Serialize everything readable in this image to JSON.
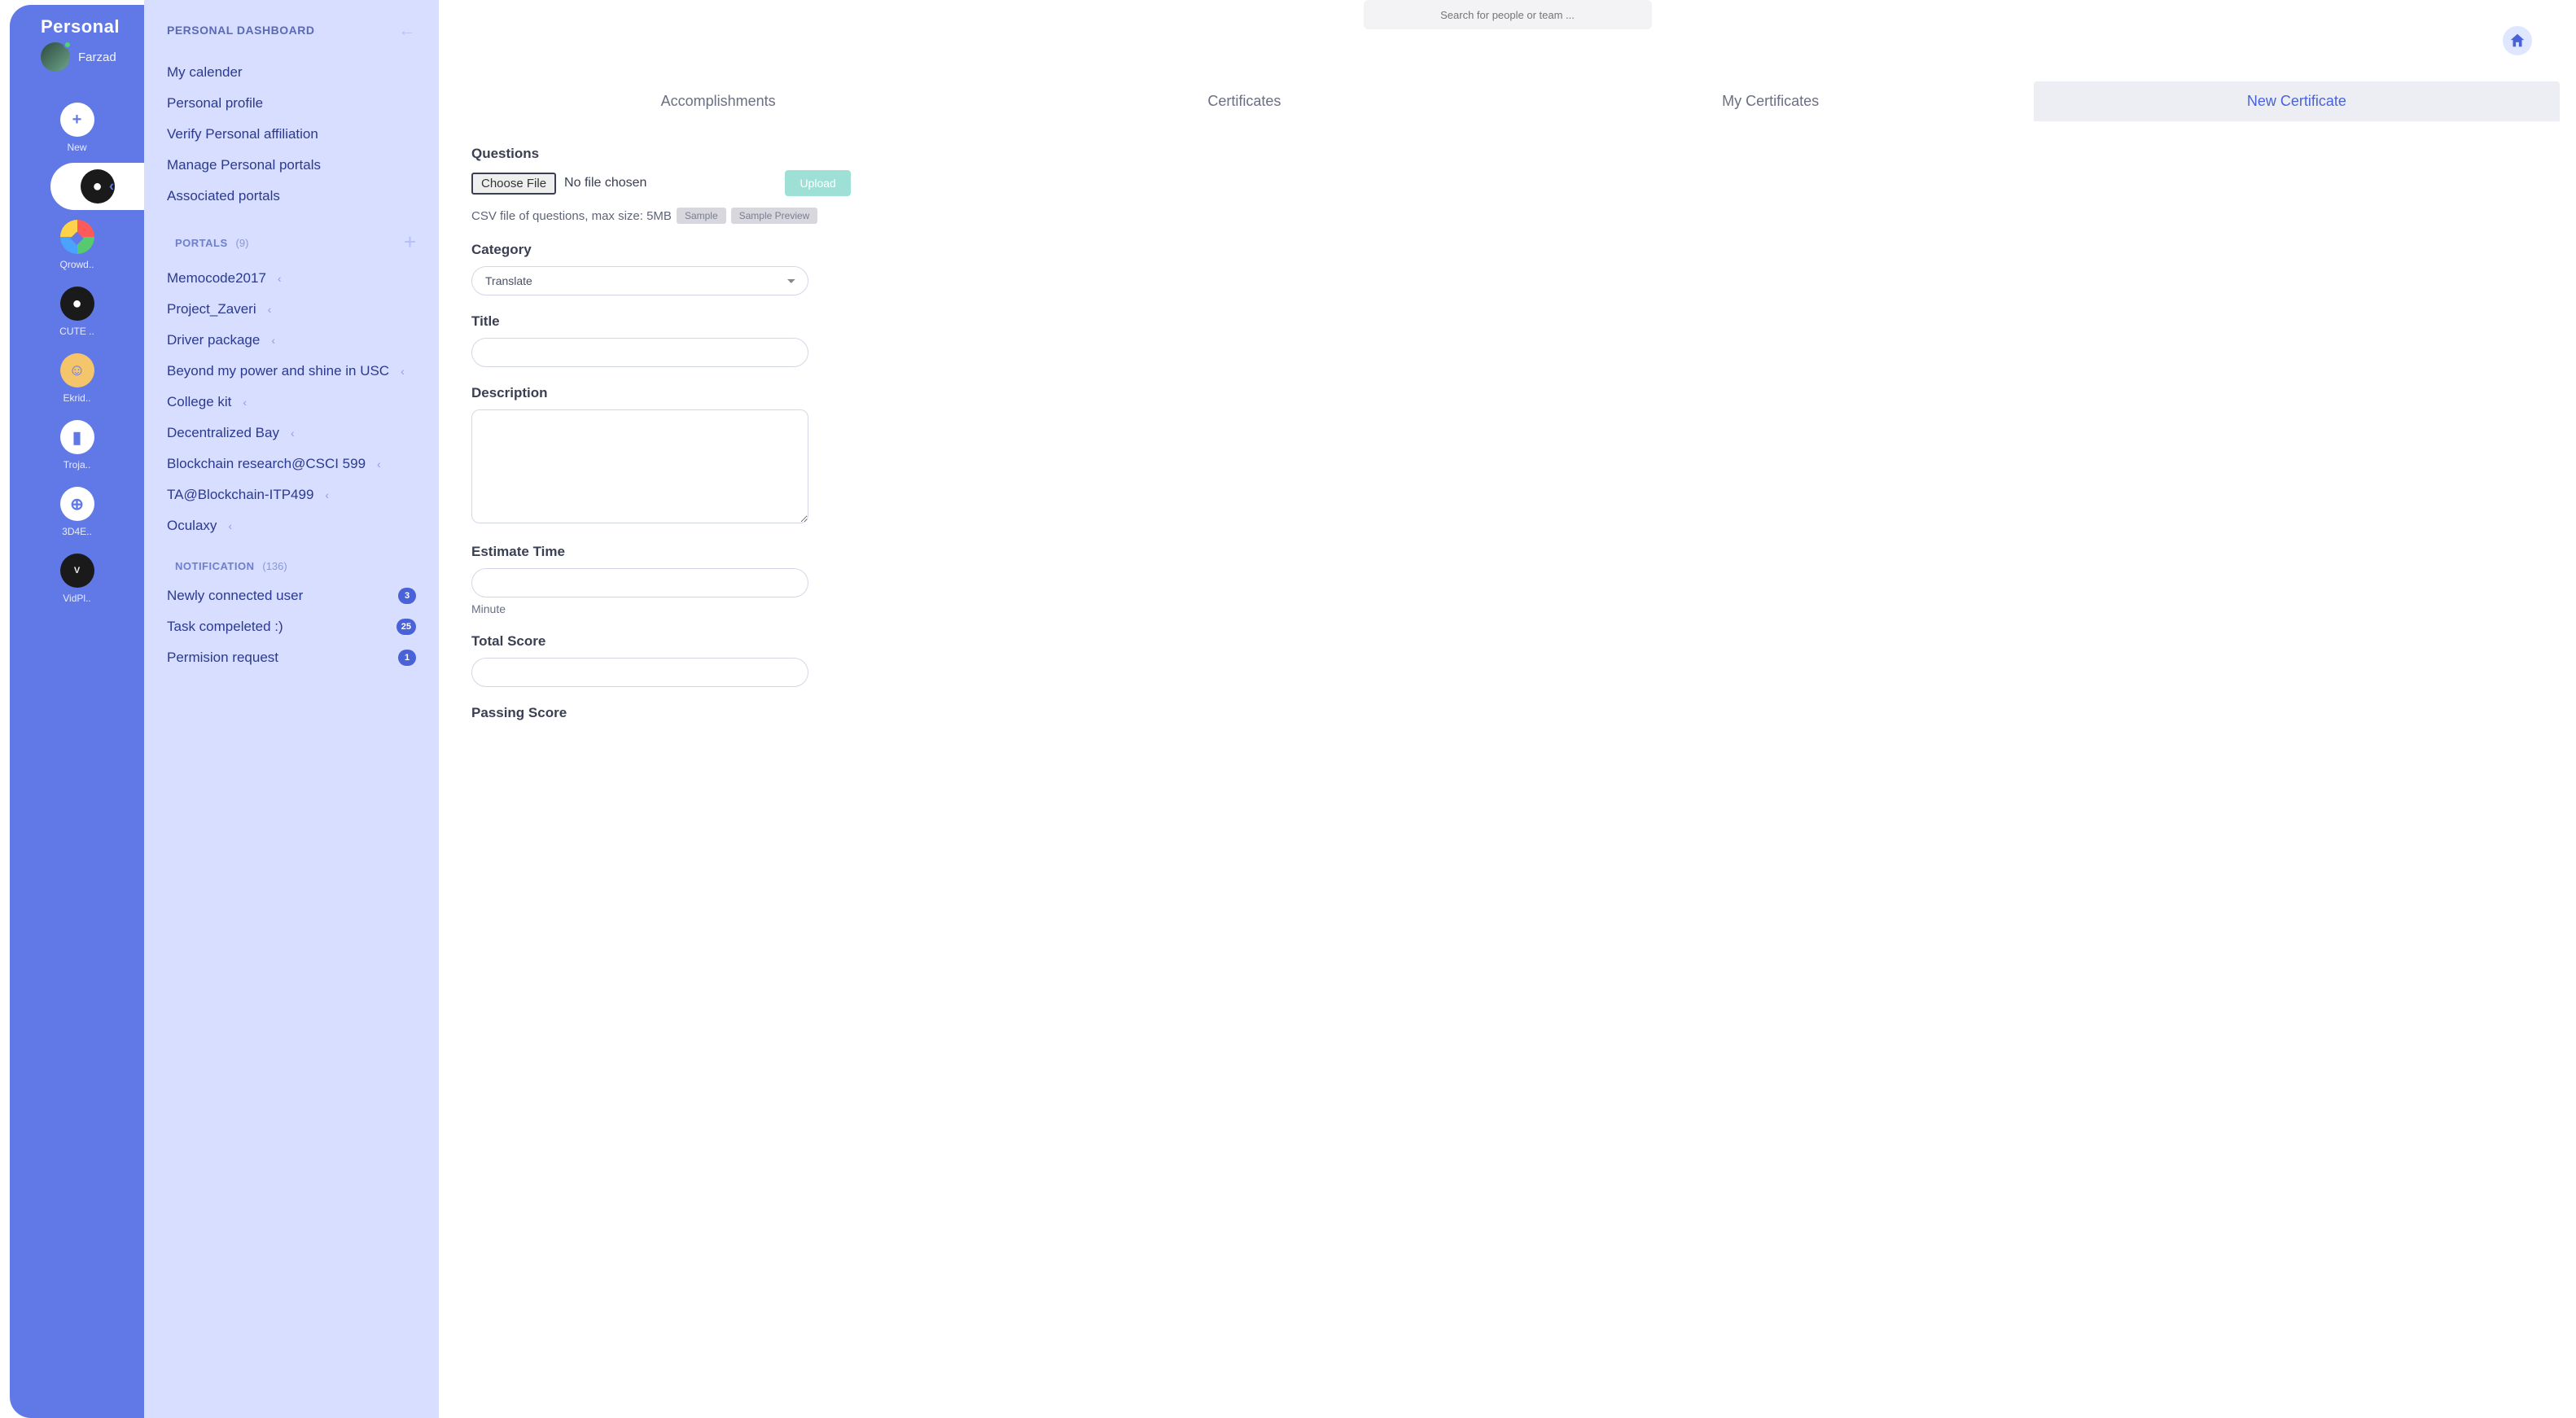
{
  "rail": {
    "title": "Personal",
    "username": "Farzad",
    "items": [
      {
        "label": "New",
        "icon": "+",
        "cls": "plain"
      },
      {
        "label": "",
        "icon": "●",
        "cls": "dark",
        "active": true
      },
      {
        "label": "Qrowd..",
        "icon": "◆",
        "cls": "multi"
      },
      {
        "label": "CUTE ..",
        "icon": "●",
        "cls": "dark"
      },
      {
        "label": "Ekrid..",
        "icon": "☺",
        "cls": "gold"
      },
      {
        "label": "Troja..",
        "icon": "▮",
        "cls": "plain"
      },
      {
        "label": "3D4E..",
        "icon": "⊕",
        "cls": "plain"
      },
      {
        "label": "VidPl..",
        "icon": "V",
        "cls": "void"
      }
    ]
  },
  "side": {
    "title": "PERSONAL DASHBOARD",
    "dashboard_items": [
      "My calender",
      "Personal profile",
      "Verify Personal affiliation",
      "Manage Personal portals",
      "Associated portals"
    ],
    "portals": {
      "title": "PORTALS",
      "count": "(9)",
      "items": [
        "Memocode2017",
        "Project_Zaveri",
        "Driver package",
        "Beyond my power and shine in USC",
        "College kit",
        "Decentralized Bay",
        "Blockchain research@CSCI 599",
        "TA@Blockchain-ITP499",
        "Oculaxy"
      ]
    },
    "notifications": {
      "title": "NOTIFICATION",
      "count": "(136)",
      "items": [
        {
          "label": "Newly connected user",
          "badge": "3"
        },
        {
          "label": "Task compeleted :)",
          "badge": "25"
        },
        {
          "label": "Permision request",
          "badge": "1"
        }
      ]
    }
  },
  "topbar": {
    "search_placeholder": "Search for people or team ..."
  },
  "tabs": [
    {
      "label": "Accomplishments"
    },
    {
      "label": "Certificates"
    },
    {
      "label": "My Certificates"
    },
    {
      "label": "New Certificate",
      "active": true
    }
  ],
  "form": {
    "questions_label": "Questions",
    "choose_file": "Choose File",
    "no_file": "No file chosen",
    "upload": "Upload",
    "csv_hint": "CSV file of questions, max size: 5MB",
    "sample": "Sample",
    "sample_preview": "Sample Preview",
    "category_label": "Category",
    "category_value": "Translate",
    "title_label": "Title",
    "description_label": "Description",
    "estimate_label": "Estimate Time",
    "estimate_hint": "Minute",
    "total_score_label": "Total Score",
    "passing_score_label": "Passing Score"
  }
}
